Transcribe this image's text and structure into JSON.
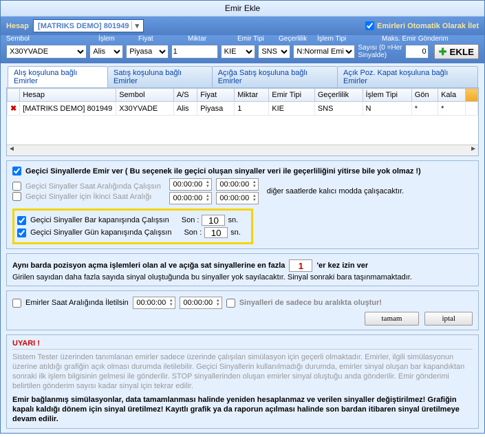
{
  "title": "Emir Ekle",
  "account_label": "Hesap",
  "account_value": "[MATRIKS DEMO] 801949",
  "auto_send_label": "Emirleri Otomatik Olarak İlet",
  "labels": {
    "sembol": "Sembol",
    "islem": "İşlem",
    "fiyat": "Fiyat",
    "miktar": "Miktar",
    "emir_tipi": "Emir Tipi",
    "gecerlilik": "Geçerlilik",
    "islem_tipi": "İşlem Tipi",
    "maks1": "Maks. Emir Gönderim",
    "maks2": "Sayısı (0 =Her",
    "maks3": "Sinyalde)"
  },
  "fields": {
    "sembol": "X30YVADE",
    "islem": "Alis",
    "fiyat": "Piyasa",
    "miktar": "1",
    "emir_tipi": "KIE",
    "gecerlilik": "SNS",
    "islem_tipi": "N:Normal Emir",
    "maks": "0"
  },
  "btn_ekle": "EKLE",
  "tabs": [
    "Alış koşuluna bağlı Emirler",
    "Satış koşuluna bağlı Emirler",
    "Açığa Satış koşuluna bağlı Emirler",
    "Açık Poz. Kapat koşuluna bağlı Emirler"
  ],
  "grid_headers": [
    "",
    "Hesap",
    "Sembol",
    "A/S",
    "Fiyat",
    "Miktar",
    "Emir Tipi",
    "Geçerlilik",
    "İşlem Tipi",
    "Gön",
    "Kala",
    ""
  ],
  "grid_row": [
    "✖",
    "[MATRIKS DEMO] 801949",
    "X30YVADE",
    "Alis",
    "Piyasa",
    "1",
    "KIE",
    "SNS",
    "N",
    "*",
    "*",
    ""
  ],
  "opt_gecici_main": "Geçici Sinyallerde Emir ver ( Bu seçenek ile geçici oluşan sinyaller veri ile geçerliliğini yitirse bile yok olmaz !)",
  "opt_saat": "Geçici Sinyaller Saat Aralığında Çalışsın",
  "opt_ikinci": "Geçici Sinyaller için İkinci Saat Aralığı",
  "time_zero": "00:00:00",
  "note_kalici": "diğer saatlerde kalıcı modda çalışacaktır.",
  "opt_bar": "Geçici Sinyaller Bar kapanışında Çalışsın",
  "opt_gun": "Geçici Sinyaller Gün kapanışında Çalışsın",
  "son_label": "Son :",
  "son_val": "10",
  "sn": "sn.",
  "aynibar1": "Aynı barda pozisyon açma işlemleri olan al ve açığa sat sinyallerine en fazla",
  "aynibar_val": "1",
  "aynibar2": "'er kez izin ver",
  "aynibar_note": "Girilen sayıdan daha fazla sayıda sinyal oluştuğunda bu sinyaller yok sayılacaktır. Sinyal sonraki bara taşınmamaktadır.",
  "emirler_saat": "Emirler Saat Aralığında İletilsin",
  "sinyaller_sadece": "Sinyalleri de sadece bu aralıkta oluştur!",
  "btn_tamam": "tamam",
  "btn_iptal": "iptal",
  "uyari_hdr": "UYARI !",
  "uyari_txt": "Sistem Tester üzerinden tanımlanan emirler sadece üzerinde çalışılan simülasyon için geçerli olmaktadır. Emirler, ilgili simülasyonun üzerine atıldığı grafiğin açık olması durumda iletilebilir. Geçici Sinyallerin kullanılmadığı durumda, emirler sinyal oluşan bar kapandıktan sonraki ilk işlem bilgisinin gelmesi ile gönderilir. STOP sinyallerinden oluşan emirler sinyal oluştuğu anda gönderilir. Emir gönderimi belirtilen gönderim sayısı kadar sinyal için tekrar edilir.",
  "uyari_bold": "Emir bağlanmış simülasyonlar, data tamamlanması halinde yeniden hesaplanmaz ve verilen sinyaller değiştirilmez! Grafiğin kapalı kaldığı dönem için sinyal üretilmez! Kayıtlı grafik ya da raporun açılması halinde son bardan itibaren sinyal üretilmeye devam edilir."
}
